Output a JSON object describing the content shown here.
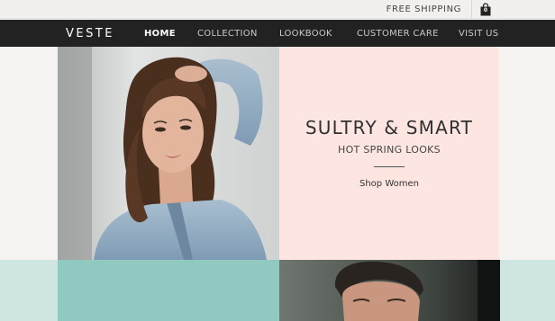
{
  "topbar": {
    "shipping_label": "FREE SHIPPING",
    "cart_count": "0",
    "cart_icon": "shopping-bag-icon"
  },
  "header": {
    "logo": "VESTE",
    "nav": [
      {
        "label": "HOME",
        "active": true
      },
      {
        "label": "COLLECTION",
        "active": false
      },
      {
        "label": "LOOKBOOK",
        "active": false
      },
      {
        "label": "CUSTOMER CARE",
        "active": false
      },
      {
        "label": "VISIT US",
        "active": false
      }
    ]
  },
  "hero": {
    "headline": "SULTRY & SMART",
    "subheadline": "HOT SPRING LOOKS",
    "cta_label": "Shop Women"
  },
  "colors": {
    "navbar": "#222222",
    "promo_panel": "#fde6e2",
    "teal_panel": "#8fc9bf",
    "mint_margin": "#cfe5df"
  }
}
